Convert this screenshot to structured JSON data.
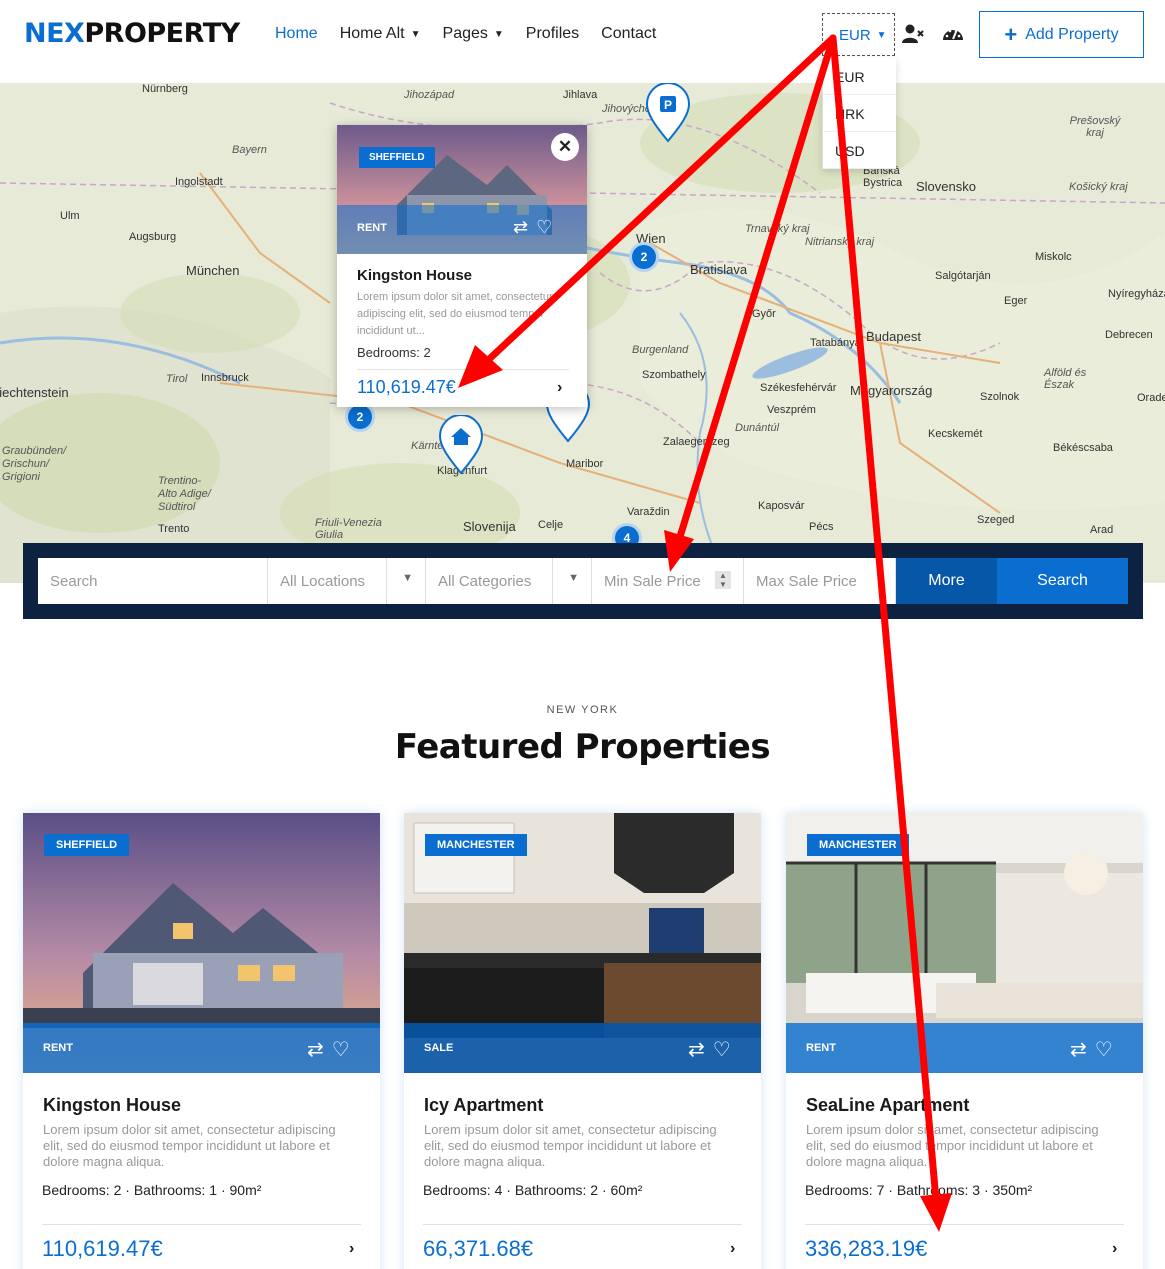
{
  "header": {
    "logo_part1": "NEX",
    "logo_part2": "PROPERTY",
    "nav": [
      {
        "label": "Home",
        "active": true
      },
      {
        "label": "Home Alt",
        "dropdown": true
      },
      {
        "label": "Pages",
        "dropdown": true
      },
      {
        "label": "Profiles"
      },
      {
        "label": "Contact"
      }
    ],
    "currency": "EUR",
    "currency_options": [
      "EUR",
      "HRK",
      "USD"
    ],
    "add_property": "Add Property",
    "icons": [
      "user-remove-icon",
      "dashboard-icon"
    ]
  },
  "map": {
    "labels": [
      "Nürnberg",
      "Jihozápad",
      "Jihlava",
      "Jihovýchod",
      "Bayern",
      "Ingolstadt",
      "Ulm",
      "Augsburg",
      "München",
      "Wien",
      "Bratislava",
      "Banská Bystrica",
      "Slovensko",
      "Košický kraj",
      "Prešovský kraj",
      "Trnavský kraj",
      "Nitriansky kraj",
      "Miskolc",
      "Salgótarján",
      "Eger",
      "Nyíregyháza",
      "Győr",
      "Tatabánya",
      "Budapest",
      "Debrecen",
      "Burgenland",
      "Szombathely",
      "Székesfehérvár",
      "Magyarország",
      "Veszprém",
      "Szolnok",
      "Alföld és Észak",
      "Tirol",
      "Innsbruck",
      "Graubünden/ Grischun/ Grigioni",
      "Trentino-Alto Adige/ Südtirol",
      "Trento",
      "Kärnten",
      "Klagenfurt",
      "Maribor",
      "Zalaegerszeg",
      "Dunántúl",
      "Kecskemét",
      "Békéscsaba",
      "Kaposvár",
      "Szeged",
      "Slovenija",
      "Celje",
      "Varaždin",
      "Pécs",
      "Friuli-Venezia Giulia",
      "Arad",
      "Oradea",
      "Liechtenstein",
      "Debrecen"
    ],
    "clusters": [
      "2",
      "2",
      "4"
    ],
    "popup": {
      "badge": "SHEFFIELD",
      "tag": "RENT",
      "title": "Kingston House",
      "desc": "Lorem ipsum dolor sit amet, consectetur adipiscing elit, sed do eiusmod tempor incididunt ut...",
      "bedrooms": "Bedrooms: 2",
      "price": "110,619.47€"
    }
  },
  "search": {
    "search_placeholder": "Search",
    "locations": "All Locations",
    "categories": "All Categories",
    "min_price": "Min Sale Price",
    "max_price": "Max Sale Price",
    "more": "More",
    "submit": "Search"
  },
  "featured": {
    "kicker": "NEW YORK",
    "title": "Featured Properties",
    "cards": [
      {
        "badge": "SHEFFIELD",
        "tag": "RENT",
        "title": "Kingston House",
        "desc": "Lorem ipsum dolor sit amet, consectetur adipiscing elit, sed do eiusmod tempor incididunt ut labore et dolore magna aliqua.",
        "meta": "Bedrooms: 2 · Bathrooms: 1 · 90m²",
        "price": "110,619.47€"
      },
      {
        "badge": "MANCHESTER",
        "tag": "SALE",
        "title": "Icy Apartment",
        "desc": "Lorem ipsum dolor sit amet, consectetur adipiscing elit, sed do eiusmod tempor incididunt ut labore et dolore magna aliqua.",
        "meta": "Bedrooms: 4 · Bathrooms: 2 · 60m²",
        "price": "66,371.68€"
      },
      {
        "badge": "MANCHESTER",
        "tag": "RENT",
        "title": "SeaLine Apartment",
        "desc": "Lorem ipsum dolor sit amet, consectetur adipiscing elit, sed do eiusmod tempor incididunt ut labore et dolore magna aliqua.",
        "meta": "Bedrooms: 7 · Bathrooms: 3 · 350m²",
        "price": "336,283.19€"
      }
    ]
  },
  "colors": {
    "accent": "#0a6ed1",
    "dark_bar": "#0d2240",
    "annotation": "#ff0000"
  }
}
